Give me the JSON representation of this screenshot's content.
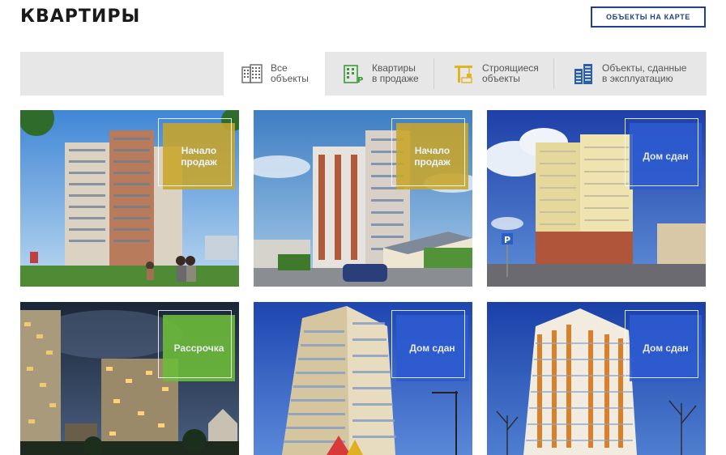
{
  "page": {
    "title": "КВАРТИРЫ"
  },
  "header": {
    "map_button_label": "ОБЪЕКТЫ НА КАРТЕ"
  },
  "filters": {
    "tabs": [
      {
        "label": "Все\nобъекты",
        "icon": "building-grid-icon",
        "active": true
      },
      {
        "label": "Квартиры\nв продаже",
        "icon": "building-parking-icon",
        "active": false
      },
      {
        "label": "Строящиеся\nобъекты",
        "icon": "crane-icon",
        "active": false
      },
      {
        "label": "Объекты, сданные\nв эксплуатацию",
        "icon": "apartment-towers-icon",
        "active": false
      }
    ]
  },
  "listings": [
    {
      "badge": "Начало\nпродаж",
      "badge_color": "#c9a62a",
      "scene": "day"
    },
    {
      "badge": "Начало\nпродаж",
      "badge_color": "#c9a62a",
      "scene": "day"
    },
    {
      "badge": "Дом сдан",
      "badge_color": "#2d5bd1",
      "scene": "day"
    },
    {
      "badge": "Рассрочка",
      "badge_color": "#6dbb3a",
      "scene": "night"
    },
    {
      "badge": "Дом сдан",
      "badge_color": "#2d5bd1",
      "scene": "day"
    },
    {
      "badge": "Дом сдан",
      "badge_color": "#2d5bd1",
      "scene": "day"
    }
  ],
  "colors": {
    "accent": "#233f8c",
    "icon_green": "#3c9a3c",
    "icon_yellow": "#e0b420",
    "icon_blue": "#2a5ea8"
  }
}
